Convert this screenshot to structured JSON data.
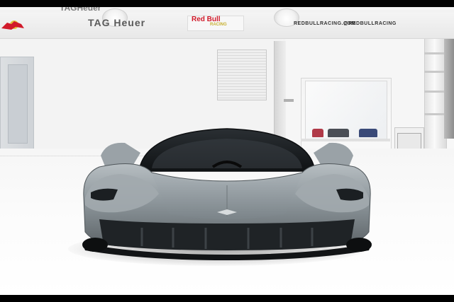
{
  "photo": {
    "subject": "hypercar-front-view",
    "setting": "white-studio-garage"
  },
  "signage": {
    "top_clip_text": "TAGHeuer",
    "tag_heuer": "TAG Heuer",
    "redbull_word": "Red Bull",
    "redbull_sub": "RACING",
    "racing_url": "REDBULLRACING.COM",
    "racing_handle": "@REDBULLRACING"
  },
  "colors": {
    "car_body": "#8f979c",
    "car_dark": "#1f2326",
    "redbull_red": "#d11a2a",
    "redbull_gold": "#e1c33a",
    "background": "#f7f7f7"
  }
}
